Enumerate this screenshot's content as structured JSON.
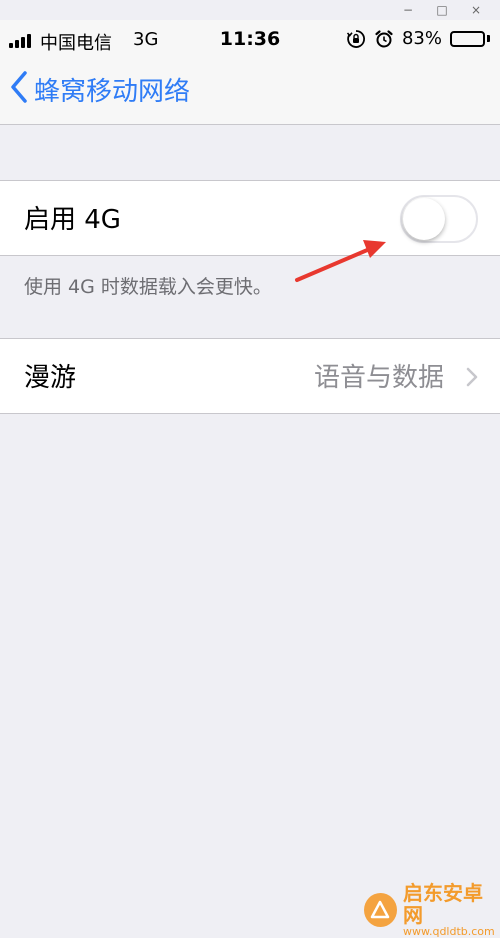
{
  "window_controls": {
    "minimize": "−",
    "maximize": "□",
    "close": "×"
  },
  "status_bar": {
    "carrier": "中国电信",
    "network": "3G",
    "time": "11:36",
    "battery_percent": "83%",
    "battery_level": 0.83,
    "icons": [
      "orientation-lock-icon",
      "alarm-icon",
      "battery-icon"
    ]
  },
  "nav": {
    "back_label": "蜂窝移动网络"
  },
  "enable_4g": {
    "label": "启用 4G",
    "enabled": false,
    "footnote": "使用 4G 时数据载入会更快。"
  },
  "roaming": {
    "label": "漫游",
    "value": "语音与数据"
  },
  "watermark": {
    "title": "启东安卓网",
    "url": "www.qdldtb.com"
  },
  "colors": {
    "accent": "#2f7cf6",
    "background": "#efeff4",
    "annotation_arrow": "#e8382f",
    "watermark": "#f39b2c"
  }
}
